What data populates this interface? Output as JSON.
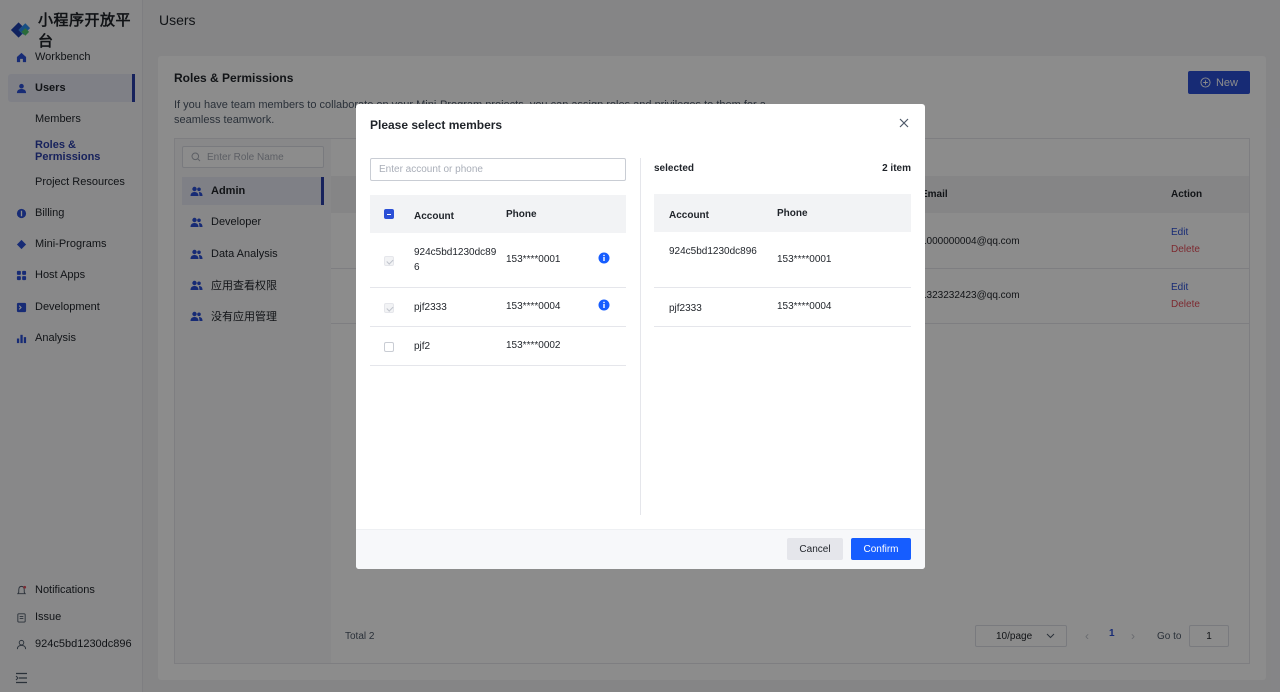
{
  "app": {
    "logo_text": "小程序开放平台"
  },
  "header": {
    "title": "Users"
  },
  "sidebar": {
    "items": [
      {
        "label": "Workbench",
        "icon": "home-icon"
      },
      {
        "label": "Users",
        "icon": "user-icon"
      },
      {
        "label": "Members"
      },
      {
        "label": "Roles & Permissions"
      },
      {
        "label": "Project Resources"
      },
      {
        "label": "Billing",
        "icon": "billing-icon"
      },
      {
        "label": "Mini-Programs",
        "icon": "diamond-icon"
      },
      {
        "label": "Host Apps",
        "icon": "grid-icon"
      },
      {
        "label": "Development",
        "icon": "code-icon"
      },
      {
        "label": "Analysis",
        "icon": "chart-icon"
      }
    ],
    "bottom": [
      {
        "label": "Notifications"
      },
      {
        "label": "Issue"
      },
      {
        "label": "924c5bd1230dc896"
      }
    ]
  },
  "card": {
    "title": "Roles & Permissions",
    "desc": "If you have team members to collaborate on your Mini-Program projects, you can assign roles and privileges to them for a seamless teamwork.",
    "new_label": "New"
  },
  "roles": {
    "search_placeholder": "Enter Role Name",
    "items": [
      "Admin",
      "Developer",
      "Data Analysis",
      "应用查看权限",
      "没有应用管理"
    ]
  },
  "table": {
    "col_email": "Email",
    "col_action": "Action",
    "rows": [
      {
        "email": "1000000004@qq.com",
        "edit": "Edit",
        "delete": "Delete"
      },
      {
        "email": "1323232423@qq.com",
        "edit": "Edit",
        "delete": "Delete"
      }
    ],
    "total": "Total 2",
    "page_size": "10/page",
    "current_page": "1",
    "goto_label": "Go to",
    "goto_value": "1"
  },
  "modal": {
    "title": "Please select members",
    "search_placeholder": "Enter account or phone",
    "col_account": "Account",
    "col_phone": "Phone",
    "candidates": [
      {
        "account": "924c5bd1230dc896",
        "phone": "153****0001",
        "state": "disabled-checked",
        "info": true
      },
      {
        "account": "pjf2333",
        "phone": "153****0004",
        "state": "disabled-checked",
        "info": true
      },
      {
        "account": "pjf2",
        "phone": "153****0002",
        "state": "unchecked",
        "info": false
      }
    ],
    "selected_label": "selected",
    "selected_count": "2 item",
    "selected": [
      {
        "account": "924c5bd1230dc896",
        "phone": "153****0001"
      },
      {
        "account": "pjf2333",
        "phone": "153****0004"
      }
    ],
    "cancel_label": "Cancel",
    "confirm_label": "Confirm"
  },
  "colors": {
    "primary": "#2b4fd6",
    "confirm": "#165dff",
    "danger": "#e34d59"
  }
}
